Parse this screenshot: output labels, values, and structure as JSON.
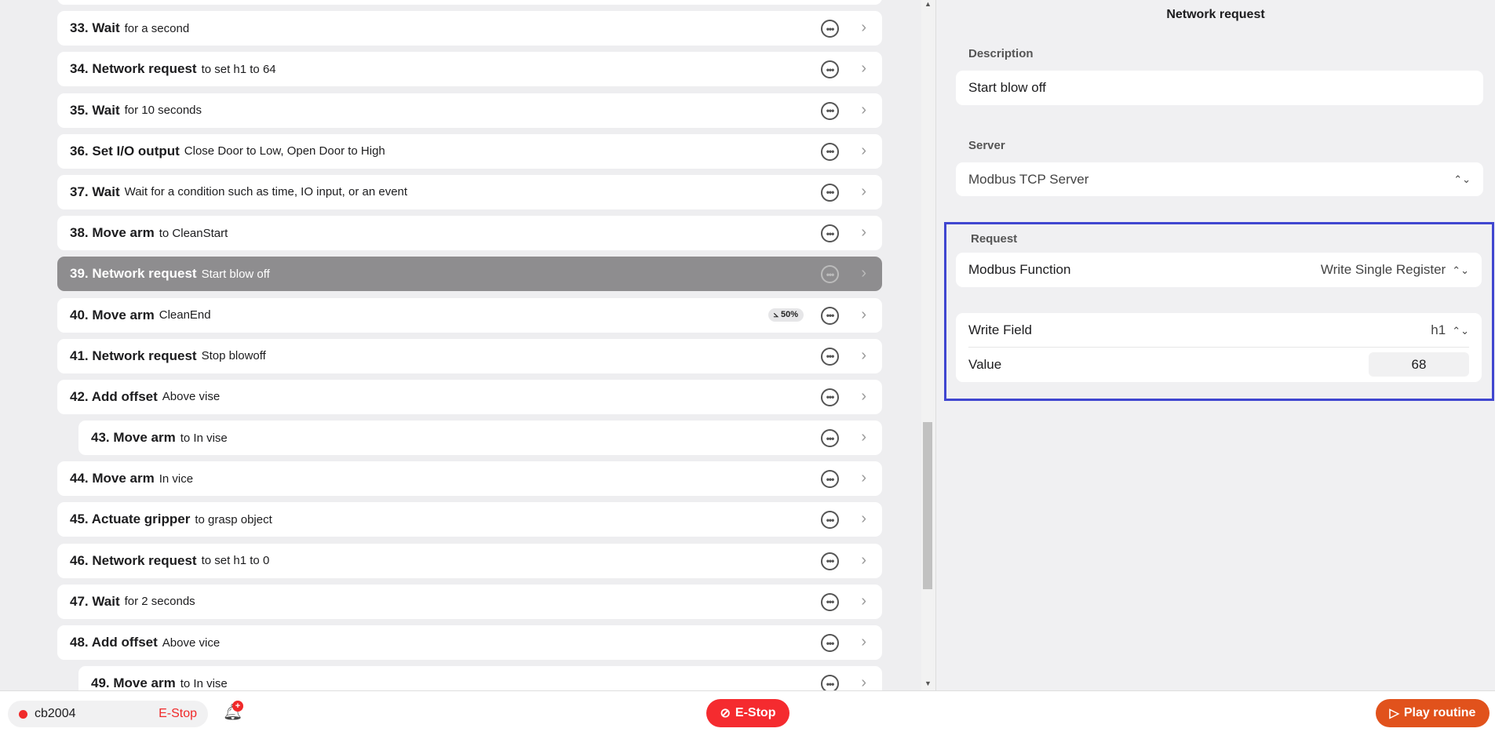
{
  "steps": [
    {
      "title": "",
      "sub": ""
    },
    {
      "title": "33. Wait",
      "sub": "for a second"
    },
    {
      "title": "34. Network request",
      "sub": "to set h1 to 64"
    },
    {
      "title": "35. Wait",
      "sub": "for 10 seconds"
    },
    {
      "title": "36. Set I/O output",
      "sub": "Close Door to Low, Open Door to High"
    },
    {
      "title": "37. Wait",
      "sub": "Wait for a condition such as time, IO input, or an event"
    },
    {
      "title": "38. Move arm",
      "sub": "to CleanStart"
    },
    {
      "title": "39. Network request",
      "sub": "Start blow off",
      "selected": true
    },
    {
      "title": "40. Move arm",
      "sub": "CleanEnd",
      "badge": "50%"
    },
    {
      "title": "41. Network request",
      "sub": "Stop blowoff"
    },
    {
      "title": "42. Add offset",
      "sub": "Above vise"
    },
    {
      "title": "43. Move arm",
      "sub": "to In vise",
      "indent": true
    },
    {
      "title": "44. Move arm",
      "sub": "In vice"
    },
    {
      "title": "45. Actuate gripper",
      "sub": "to grasp object"
    },
    {
      "title": "46. Network request",
      "sub": "to set h1 to 0"
    },
    {
      "title": "47. Wait",
      "sub": "for 2 seconds"
    },
    {
      "title": "48. Add offset",
      "sub": "Above vice"
    },
    {
      "title": "49. Move arm",
      "sub": "to In vise",
      "indent": true
    }
  ],
  "panel": {
    "title": "Network request",
    "description_label": "Description",
    "description_value": "Start blow off",
    "server_label": "Server",
    "server_value": "Modbus TCP Server",
    "request_label": "Request",
    "function_label": "Modbus Function",
    "function_value": "Write Single Register",
    "write_field_label": "Write Field",
    "write_field_value": "h1",
    "value_label": "Value",
    "value_value": "68"
  },
  "bottom": {
    "robot_name": "cb2004",
    "robot_estop": "E-Stop",
    "notification_badge": "+",
    "estop_label": "E-Stop",
    "play_label": "Play routine"
  },
  "colors": {
    "highlight_border": "#4046d0",
    "estop": "#f52b2f",
    "play": "#e1521c",
    "selected_row": "#8e8d8f"
  }
}
